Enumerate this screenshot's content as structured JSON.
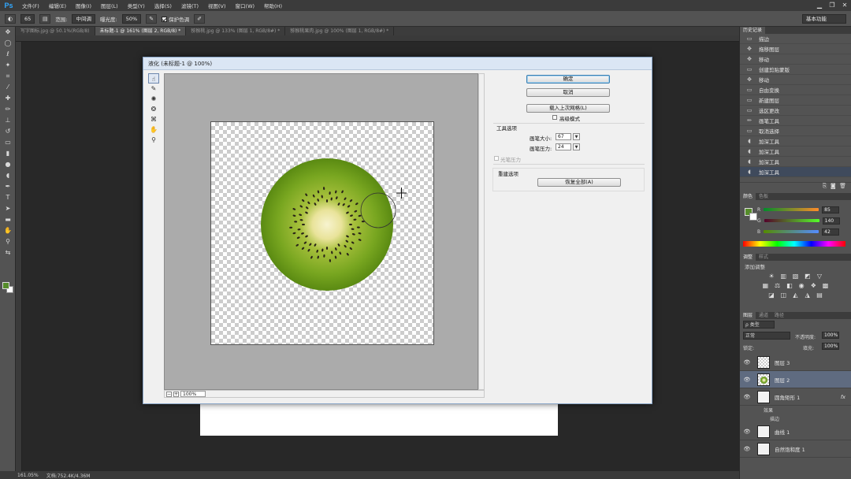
{
  "app": {
    "logo": "Ps",
    "menus": [
      "文件(F)",
      "编辑(E)",
      "图像(I)",
      "图层(L)",
      "类型(Y)",
      "选择(S)",
      "滤镜(T)",
      "视图(V)",
      "窗口(W)",
      "帮助(H)"
    ],
    "window_controls": [
      "▁",
      "❐",
      "✕"
    ]
  },
  "options_bar": {
    "brush_size": "65",
    "range_label": "范围:",
    "range_value": "中间调",
    "exposure_label": "曝光度:",
    "exposure_value": "50%",
    "protect_tone_label": "保护色调",
    "protect_tone_checked": true,
    "workspace": "基本功能"
  },
  "doc_tabs": [
    "写字图标.jpg @ 50.1%(RGB/8)",
    "未标题-1 @ 161% (图层 2, RGB/8) *",
    "猕猴桃.jpg @ 133% (图层 1, RGB/8#) *",
    "猕猴桃果肉.jpg @ 100% (图层 1, RGB/8#) *"
  ],
  "active_tab": 1,
  "status_bar": {
    "zoom": "161.05%",
    "doc_info": "文档:752.4K/4.36M"
  },
  "colors": {
    "foreground": "#558c2a",
    "background": "#ffffff",
    "accent": "#3c7fb1"
  },
  "liquify": {
    "title": "液化 (未标题-1 @ 100%)",
    "tools": [
      "forward-warp",
      "reconstruct",
      "pucker",
      "bloat",
      "push-left",
      "hand",
      "zoom"
    ],
    "ok_label": "确定",
    "cancel_label": "取消",
    "load_mesh_label": "载入上次网格(L)",
    "advanced_label": "高级模式",
    "advanced_checked": false,
    "tool_options_label": "工具选项",
    "brush_size_label": "画笔大小:",
    "brush_size_value": "67",
    "brush_pressure_label": "画笔压力:",
    "brush_pressure_value": "24",
    "stylus_label": "光笔压力",
    "rebuild_label": "重建选项",
    "restore_label": "恢复全部(A)",
    "zoom_value": "100%"
  },
  "history": {
    "tabs": [
      "历史记录"
    ],
    "items": [
      {
        "icon": "layer",
        "label": "描边"
      },
      {
        "icon": "move",
        "label": "拖移图层"
      },
      {
        "icon": "move",
        "label": "移动"
      },
      {
        "icon": "layer",
        "label": "创建剪贴蒙版"
      },
      {
        "icon": "move",
        "label": "移动"
      },
      {
        "icon": "layer",
        "label": "自由变换"
      },
      {
        "icon": "layer",
        "label": "新建图层"
      },
      {
        "icon": "layer",
        "label": "选区更改"
      },
      {
        "icon": "brush",
        "label": "画笔工具"
      },
      {
        "icon": "layer",
        "label": "取消选择"
      },
      {
        "icon": "burn",
        "label": "加深工具"
      },
      {
        "icon": "burn",
        "label": "加深工具"
      },
      {
        "icon": "burn",
        "label": "加深工具"
      },
      {
        "icon": "burn",
        "label": "加深工具"
      }
    ]
  },
  "color_panel": {
    "tabs": [
      "颜色",
      "色板"
    ],
    "r_label": "R",
    "r_value": "85",
    "g_label": "G",
    "g_value": "140",
    "b_label": "B",
    "b_value": "42"
  },
  "adjustments": {
    "tabs": [
      "调整",
      "样式"
    ],
    "title": "添加调整"
  },
  "layers": {
    "tabs": [
      "图层",
      "通道",
      "路径"
    ],
    "filter_label": "ρ 类型",
    "blend_mode": "正常",
    "opacity_label": "不透明度:",
    "opacity_value": "100%",
    "lock_label": "锁定:",
    "fill_label": "填充:",
    "fill_value": "100%",
    "items": [
      {
        "name": "图层 3"
      },
      {
        "name": "图层 2"
      },
      {
        "name": "圆角矩形 1"
      },
      {
        "name": "效果"
      },
      {
        "name": "描边"
      },
      {
        "name": "曲线 1"
      },
      {
        "name": "自然饱和度 1"
      }
    ]
  }
}
